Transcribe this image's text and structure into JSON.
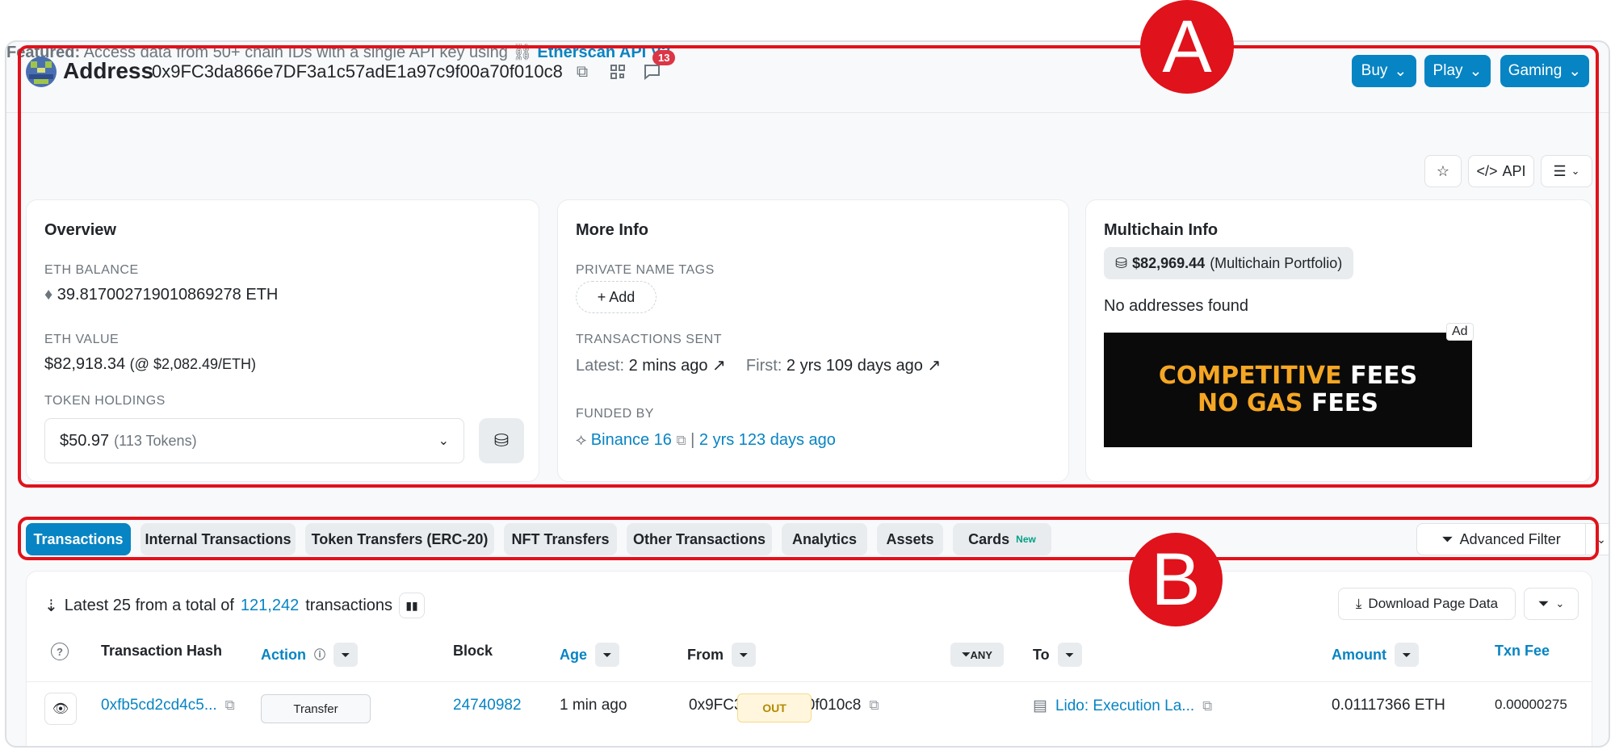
{
  "header": {
    "title": "Address",
    "address": "0x9FC3da866e7DF3a1c57adE1a97c9f00a70f010c8",
    "comment_count": "13",
    "buttons": [
      {
        "label": "Buy"
      },
      {
        "label": "Play"
      },
      {
        "label": "Gaming"
      }
    ]
  },
  "featured": {
    "label": "Featured:",
    "text": "Access data from 50+ chain IDs with a single API key using",
    "link": "Etherscan API V2."
  },
  "toolbar": {
    "api_label": "API"
  },
  "overview": {
    "title": "Overview",
    "eth_balance_label": "ETH BALANCE",
    "eth_balance": "39.817002719010869278 ETH",
    "eth_value_label": "ETH VALUE",
    "eth_value": "$82,918.34",
    "eth_price": "(@ $2,082.49/ETH)",
    "token_holdings_label": "TOKEN HOLDINGS",
    "token_value": "$50.97",
    "token_count": "(113 Tokens)"
  },
  "more_info": {
    "title": "More Info",
    "private_tags_label": "PRIVATE NAME TAGS",
    "add_label": "+ Add",
    "tx_sent_label": "TRANSACTIONS SENT",
    "latest_label": "Latest:",
    "latest_value": "2 mins ago",
    "first_label": "First:",
    "first_value": "2 yrs 109 days ago",
    "funded_by_label": "FUNDED BY",
    "funded_by": "Binance 16",
    "funded_age": "2 yrs 123 days ago"
  },
  "multichain": {
    "title": "Multichain Info",
    "portfolio_value": "$82,969.44",
    "portfolio_label": "(Multichain Portfolio)",
    "no_addresses": "No addresses found",
    "ad_tag": "Ad",
    "ad_line1_a": "COMPETITIVE",
    "ad_line1_b": "FEES",
    "ad_line2_a": "NO GAS",
    "ad_line2_b": "FEES"
  },
  "tabs": [
    {
      "label": "Transactions",
      "active": true
    },
    {
      "label": "Internal Transactions"
    },
    {
      "label": "Token Transfers (ERC-20)"
    },
    {
      "label": "NFT Transfers"
    },
    {
      "label": "Other Transactions"
    },
    {
      "label": "Analytics"
    },
    {
      "label": "Assets"
    },
    {
      "label": "Cards",
      "badge": "New"
    }
  ],
  "advanced_filter": "Advanced Filter",
  "table": {
    "summary_prefix": "Latest 25 from a total of",
    "total": "121,242",
    "summary_suffix": "transactions",
    "download_label": "Download Page Data",
    "columns": {
      "hash": "Transaction Hash",
      "action": "Action",
      "block": "Block",
      "age": "Age",
      "from": "From",
      "any": "ANY",
      "to": "To",
      "amount": "Amount",
      "fee": "Txn Fee"
    },
    "rows": [
      {
        "hash": "0xfb5cd2cd4c5...",
        "method": "Transfer",
        "block": "24740982",
        "age": "1 min ago",
        "from": "0x9FC3da86...a70f010c8",
        "direction": "OUT",
        "to": "Lido: Execution La...",
        "amount": "0.01117366 ETH",
        "fee": "0.00000275"
      }
    ]
  },
  "annotations": {
    "a": "A",
    "b": "B"
  },
  "colors": {
    "accent": "#0784c3",
    "annotation": "#e0121b"
  }
}
